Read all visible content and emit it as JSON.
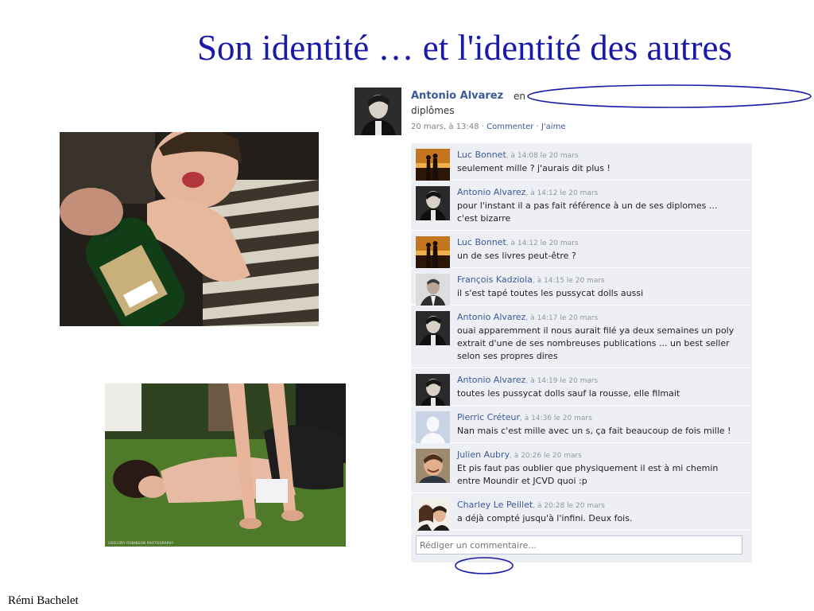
{
  "slide": {
    "title": "Son identité … et l'identité des autres",
    "author": "Rémi Bachelet"
  },
  "photos": {
    "party_photo": {
      "label": ""
    },
    "grass_photo": {
      "credit": "GREGORY ROBINSON PHOTOGRAPHY"
    }
  },
  "post": {
    "author": "Antonio Alvarez",
    "text_prefix": "en",
    "text_line2": "diplômes",
    "date": "20 mars, à 13:48",
    "separator": "·",
    "comment_link": "Commenter",
    "like_link": "J'aime"
  },
  "comments": [
    {
      "name": "Luc Bonnet",
      "time": "à 14:08 le 20 mars",
      "text": "seulement mille ? j'aurais dit plus !",
      "avatar": "sunset-couple"
    },
    {
      "name": "Antonio Alvarez",
      "time": "à 14:12 le 20 mars",
      "text": "pour l'instant il a pas fait référence à un de ses diplomes ...\nc'est bizarre",
      "avatar": "man-dark"
    },
    {
      "name": "Luc Bonnet",
      "time": "à 14:12 le 20 mars",
      "text": "un de ses livres peut-être ?",
      "avatar": "sunset-couple"
    },
    {
      "name": "François Kadziola",
      "time": "à 14:15 le 20 mars",
      "text": "il s'est tapé toutes les pussycat dolls aussi",
      "avatar": "man-suit"
    },
    {
      "name": "Antonio Alvarez",
      "time": "à 14:17 le 20 mars",
      "text": "ouai apparemment il nous aurait filé ya deux semaines un poly\nextrait d'une de ses nombreuses publications ... un best seller\nselon ses propres dires",
      "avatar": "man-dark"
    },
    {
      "name": "Antonio Alvarez",
      "time": "à 14:19 le 20 mars",
      "text": "toutes les pussycat dolls sauf la rousse, elle filmait",
      "avatar": "man-dark"
    },
    {
      "name": "Pierric Créteur",
      "time": "à 14:36 le 20 mars",
      "text": "Nan mais c'est mille avec un s, ça fait beaucoup de fois mille !",
      "avatar": "default-silhouette"
    },
    {
      "name": "Julien Aubry",
      "time": "à 20:26 le 20 mars",
      "text": "Et pis faut pas oublier que physiquement il est à mi chemin\nentre Moundir et JCVD quoi :p",
      "avatar": "man-smiling"
    },
    {
      "name": "Charley Le Peillet",
      "time": "à 20:28 le 20 mars",
      "text": "a déjà compté jusqu'à l'infini. Deux fois.",
      "avatar": "two-people"
    }
  ],
  "comment_input": {
    "placeholder": "Rédiger un commentaire..."
  },
  "colors": {
    "title": "#1a1aa8",
    "fb_link": "#3b5998",
    "fb_comment_bg": "#edeff4",
    "annotation": "#1a1aa8"
  },
  "icons": [
    "post-avatar-man",
    "sunset-couple-avatar",
    "man-dark-avatar",
    "man-suit-avatar",
    "default-silhouette-avatar",
    "man-smiling-avatar",
    "two-people-avatar"
  ]
}
